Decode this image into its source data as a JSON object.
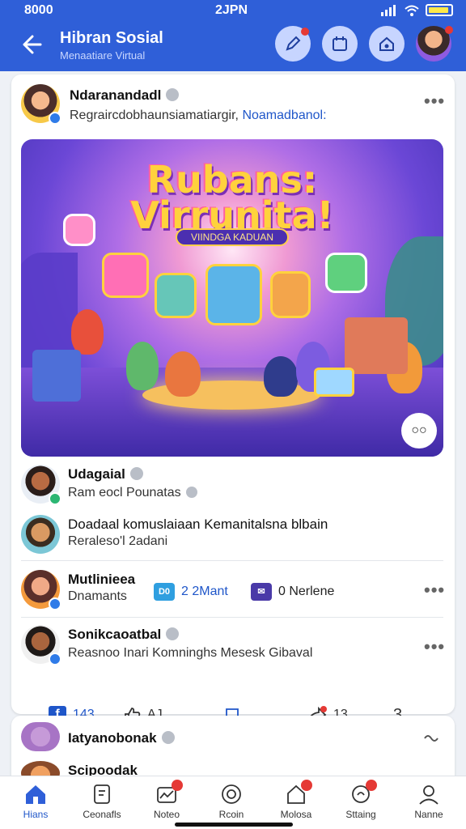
{
  "status": {
    "time_left": "8000",
    "time_center": "2JPN"
  },
  "header": {
    "title": "Hibran Sosial",
    "subtitle": "Menaatiare Virtual"
  },
  "post": {
    "author": "Ndaranandadl",
    "text_prefix": "Regraircdobhaunsiamatiargir,",
    "text_link": "Noamadbanol:",
    "image": {
      "title_line1": "Rubans:",
      "title_line2": "Virrunita!",
      "tag": "VIINDGA KADUAN"
    }
  },
  "comments": [
    {
      "name": "Udagaial",
      "text": "Ram eocl Pounatas"
    },
    {
      "name": "Doadaal komuslaiaan Kemanitalsna blbain",
      "text": "Reraleso'l 2adani"
    }
  ],
  "row_mutlineea": {
    "name": "Mutlinieea",
    "text": "Dnamants",
    "meta1_icon": "D0",
    "meta1_label": "2 2Mant",
    "meta2_label": "0 Nerlene"
  },
  "row_sonik": {
    "name": "Sonikcaoatbal",
    "text": "Reasnoo Inari Komninghs Mesesk Gibaval"
  },
  "action_bar": {
    "like_count": "143",
    "react_count": "AJ",
    "share_count": "13",
    "menu_label": "3"
  },
  "card2": {
    "row1": "Iatyanobonak",
    "row2": "Scipoodak"
  },
  "tabs": [
    {
      "label": "Hians",
      "icon": "home-icon",
      "active": true
    },
    {
      "label": "Ceonafls",
      "icon": "document-icon"
    },
    {
      "label": "Noteo",
      "icon": "notification-icon"
    },
    {
      "label": "Rcoin",
      "icon": "circle-icon"
    },
    {
      "label": "Molosa",
      "icon": "house-alert-icon"
    },
    {
      "label": "Sttaing",
      "icon": "settings-icon"
    },
    {
      "label": "Nanne",
      "icon": "profile-icon"
    }
  ],
  "colors": {
    "brand": "#2f5fd8",
    "link": "#1f56c9",
    "alert": "#e53935"
  }
}
